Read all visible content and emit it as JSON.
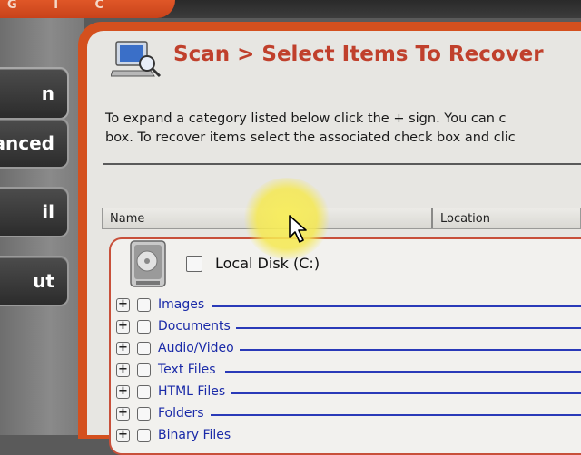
{
  "brand": {
    "text": "G I C"
  },
  "sidebar": {
    "buttons": [
      {
        "label": "n"
      },
      {
        "label": "anced"
      },
      {
        "label": "il"
      },
      {
        "label": "ut"
      }
    ]
  },
  "page": {
    "title": "Scan > Select Items To Recover",
    "instructions": [
      "To expand a category listed below click the + sign.  You can c",
      "box.  To recover items select the associated check box and clic"
    ]
  },
  "columns": {
    "name": "Name",
    "location": "Location"
  },
  "tree": {
    "root": {
      "label": "Local Disk (C:)",
      "icon": "hard-drive-icon",
      "checked": false
    },
    "items": [
      {
        "label": "Images",
        "checked": false
      },
      {
        "label": "Documents",
        "checked": false
      },
      {
        "label": "Audio/Video",
        "checked": false
      },
      {
        "label": "Text Files",
        "checked": false
      },
      {
        "label": "HTML Files",
        "checked": false
      },
      {
        "label": "Folders",
        "checked": false
      },
      {
        "label": "Binary Files",
        "checked": false
      }
    ]
  },
  "colors": {
    "accent": "#d4501e",
    "title": "#c0402c",
    "link": "#1a2aa8"
  }
}
